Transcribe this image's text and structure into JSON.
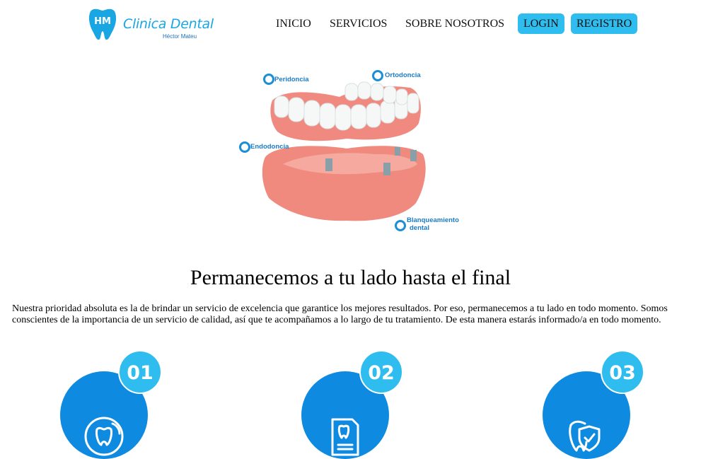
{
  "brand": {
    "mark": "HM",
    "title": "Clinica Dental",
    "subtitle": "Héctor Mateu"
  },
  "nav": {
    "inicio": "INICIO",
    "servicios": "SERVICIOS",
    "sobre": "SOBRE NOSOTROS",
    "login": "LOGIN",
    "registro": "REGISTRO"
  },
  "hero": {
    "labels": {
      "peridoncia": "Peridoncia",
      "ortodoncia": "Ortodoncia",
      "endodoncia": "Endodoncia",
      "blanqueamiento_1": "Blanqueamiento",
      "blanqueamiento_2": "dental"
    }
  },
  "section": {
    "title": "Permanecemos a tu lado hasta el final",
    "body": "Nuestra prioridad absoluta es la de brindar un servicio de excelencia que garantice los mejores resultados. Por eso, permanecemos a tu lado en todo momento. Somos conscientes de la importancia de un servicio de calidad, así que te acompañamos a lo largo de tu tratamiento. De esta manera estarás informado/a en todo momento."
  },
  "steps": [
    {
      "number": "01",
      "icon": "tooth-phone-icon"
    },
    {
      "number": "02",
      "icon": "tooth-document-icon"
    },
    {
      "number": "03",
      "icon": "tooth-shield-icon"
    }
  ],
  "colors": {
    "brand_blue": "#1aa6e3",
    "button_blue": "#2ebdee",
    "circle_blue": "#0e8be0",
    "gum_pink": "#f0897e"
  }
}
